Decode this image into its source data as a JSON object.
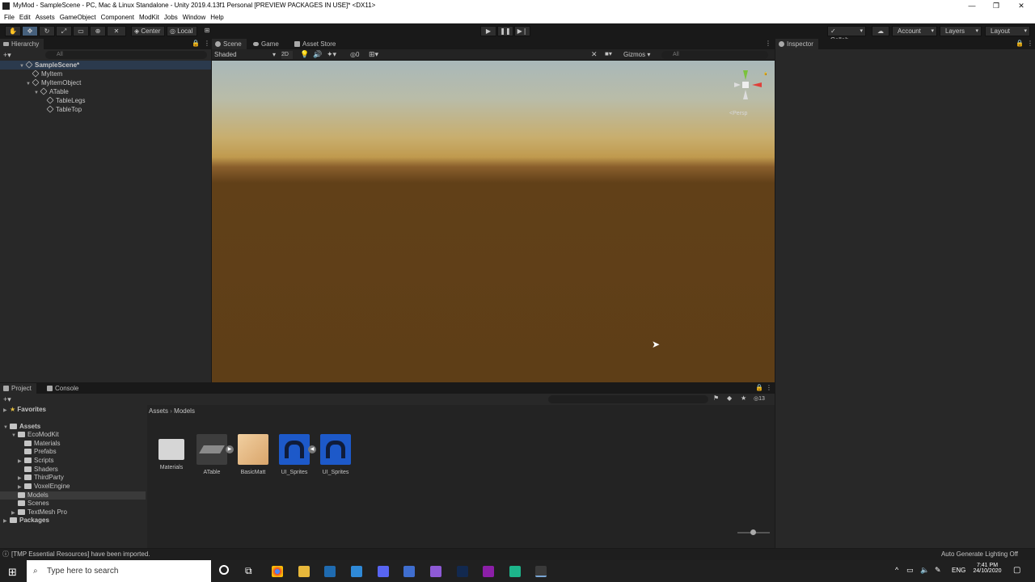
{
  "window": {
    "title": "MyMod - SampleScene - PC, Mac & Linux Standalone - Unity 2019.4.13f1 Personal [PREVIEW PACKAGES IN USE]* <DX11>",
    "minimize": "—",
    "maximize": "❐",
    "close": "✕"
  },
  "menu": [
    "File",
    "Edit",
    "Assets",
    "GameObject",
    "Component",
    "ModKit",
    "Jobs",
    "Window",
    "Help"
  ],
  "toolbar": {
    "pivot_center": "Center",
    "pivot_local": "Local",
    "collab": "Collab",
    "account": "Account",
    "layers": "Layers",
    "layout": "Layout"
  },
  "hierarchy": {
    "tab": "Hierarchy",
    "search_placeholder": "All",
    "items": [
      {
        "label": "SampleScene*"
      },
      {
        "label": "MyItem"
      },
      {
        "label": "MyItemObject"
      },
      {
        "label": "ATable"
      },
      {
        "label": "TableLegs"
      },
      {
        "label": "TableTop"
      }
    ]
  },
  "scene": {
    "tabs": [
      "Scene",
      "Game",
      "Asset Store"
    ],
    "shading_mode": "Shaded",
    "mode_2d": "2D",
    "hidden_count": "0",
    "gizmos": "Gizmos",
    "search_placeholder": "All",
    "persp_label": "<Persp"
  },
  "inspector": {
    "tab": "Inspector"
  },
  "project": {
    "tabs": [
      "Project",
      "Console"
    ],
    "favorites": "Favorites",
    "tree": [
      {
        "label": "Assets"
      },
      {
        "label": "EcoModKit"
      },
      {
        "label": "Materials"
      },
      {
        "label": "Prefabs"
      },
      {
        "label": "Scripts"
      },
      {
        "label": "Shaders"
      },
      {
        "label": "ThirdParty"
      },
      {
        "label": "VoxelEngine"
      },
      {
        "label": "Models"
      },
      {
        "label": "Scenes"
      },
      {
        "label": "TextMesh Pro"
      },
      {
        "label": "Packages"
      }
    ],
    "breadcrumb": [
      "Assets",
      "Models"
    ],
    "hidden_packages_count": "13",
    "assets": [
      {
        "label": "Materials",
        "type": "folder"
      },
      {
        "label": "ATable",
        "type": "model"
      },
      {
        "label": "BasicMatt",
        "type": "material"
      },
      {
        "label": "UI_Sprites",
        "type": "sprite"
      },
      {
        "label": "UI_Sprites",
        "type": "sprite"
      }
    ]
  },
  "status": {
    "message": "[TMP Essential Resources] have been imported.",
    "right": "Auto Generate Lighting Off"
  },
  "taskbar": {
    "search_placeholder": "Type here to search",
    "language": "ENG",
    "time": "7:41 PM",
    "date": "24/10/2020"
  },
  "colors": {
    "accent": "#46607c",
    "panel": "#282828",
    "sky": "#a9b8b9",
    "horizon": "#c8ae6e",
    "ground": "#5e3e17"
  }
}
